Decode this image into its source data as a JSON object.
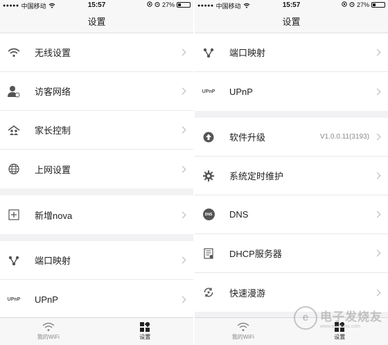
{
  "status": {
    "carrier": "中国移动",
    "time": "15:57",
    "battery_text": "27%",
    "battery_level": 0.27
  },
  "left": {
    "title": "设置",
    "group1": [
      {
        "label": "无线设置",
        "icon": "wifi-icon"
      },
      {
        "label": "访客网络",
        "icon": "guest-user-icon"
      },
      {
        "label": "家长控制",
        "icon": "parental-control-icon"
      },
      {
        "label": "上网设置",
        "icon": "globe-icon"
      }
    ],
    "group2": [
      {
        "label": "新增nova",
        "icon": "add-box-icon"
      }
    ],
    "group3": [
      {
        "label": "端口映射",
        "icon": "port-mapping-icon"
      },
      {
        "label": "UPnP",
        "icon": "upnp-icon",
        "icon_text": "UPnP"
      }
    ]
  },
  "right": {
    "title": "设置",
    "group1": [
      {
        "label": "端口映射",
        "icon": "port-mapping-icon"
      },
      {
        "label": "UPnP",
        "icon": "upnp-icon",
        "icon_text": "UPnP"
      }
    ],
    "group2": [
      {
        "label": "软件升级",
        "icon": "upgrade-icon",
        "value": "V1.0.0.11(3193)"
      },
      {
        "label": "系统定时维护",
        "icon": "gear-icon"
      },
      {
        "label": "DNS",
        "icon": "dns-icon",
        "icon_text": "DNS"
      },
      {
        "label": "DHCP服务器",
        "icon": "dhcp-server-icon"
      },
      {
        "label": "快速漫游",
        "icon": "fast-roaming-icon"
      }
    ]
  },
  "tabs": [
    {
      "label": "我的WiFi",
      "icon": "wifi-tab-icon",
      "active": false
    },
    {
      "label": "设置",
      "icon": "settings-grid-icon",
      "active": true
    }
  ],
  "watermark": {
    "text": "电子发烧友",
    "url": "www.elecfans.com",
    "logo_char": "e"
  }
}
